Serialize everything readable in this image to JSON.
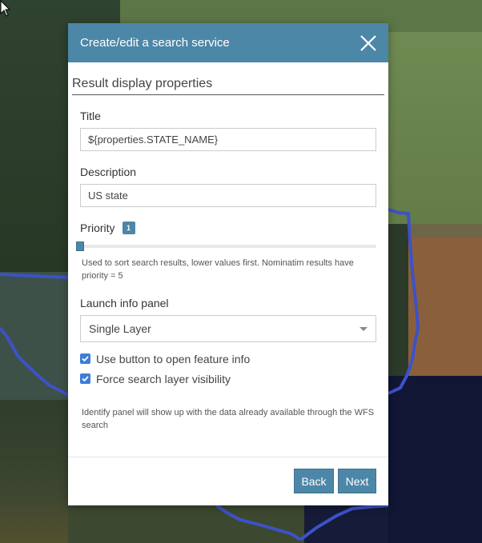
{
  "dialog": {
    "title": "Create/edit a search service",
    "section_title": "Result display properties"
  },
  "form": {
    "title_label": "Title",
    "title_value": "${properties.STATE_NAME}",
    "description_label": "Description",
    "description_value": "US state",
    "priority_label": "Priority",
    "priority_value": "1",
    "priority_help": "Used to sort search results, lower values first. Nominatim results have priority = 5",
    "launch_label": "Launch info panel",
    "launch_selected": "Single Layer",
    "checkbox_feature_info": "Use button to open feature info",
    "checkbox_force_visibility": "Force search layer visibility",
    "identify_help": "Identify panel will show up with the data already available through the WFS search"
  },
  "buttons": {
    "back": "Back",
    "next": "Next"
  },
  "colors": {
    "accent": "#4d87a8",
    "checkbox": "#3d7dd8",
    "state_border": "#3d52c8"
  }
}
